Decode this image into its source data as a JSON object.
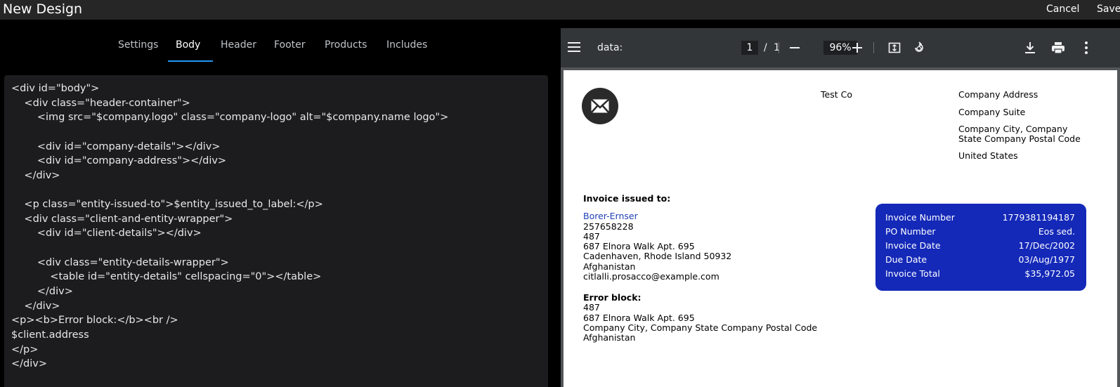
{
  "app": {
    "title": "New Design",
    "cancel_label": "Cancel",
    "save_label": "Save"
  },
  "tabs": [
    {
      "label": "Settings"
    },
    {
      "label": "Body",
      "active": true
    },
    {
      "label": "Header"
    },
    {
      "label": "Footer"
    },
    {
      "label": "Products"
    },
    {
      "label": "Includes"
    }
  ],
  "code": {
    "lines": [
      "<div id=\"body\">",
      "    <div class=\"header-container\">",
      "        <img src=\"$company.logo\" class=\"company-logo\" alt=\"$company.name logo\">",
      "",
      "        <div id=\"company-details\"></div>",
      "        <div id=\"company-address\"></div>",
      "    </div>",
      "",
      "    <p class=\"entity-issued-to\">$entity_issued_to_label:</p>",
      "    <div class=\"client-and-entity-wrapper\">",
      "        <div id=\"client-details\"></div>",
      "",
      "        <div class=\"entity-details-wrapper\">",
      "            <table id=\"entity-details\" cellspacing=\"0\"></table>",
      "        </div>",
      "    </div>",
      "<p><b>Error block:</b><br />",
      "$client.address",
      "</p>",
      "</div>"
    ]
  },
  "viewer": {
    "filename": "data:",
    "page_current": "1",
    "page_separator": "/",
    "page_total": "1",
    "zoom": "96%",
    "icons": {
      "menu": "menu-icon",
      "zoom_out": "minus-icon",
      "zoom_in": "plus-icon",
      "fit": "fit-page-icon",
      "rotate": "rotate-icon",
      "download": "download-icon",
      "print": "print-icon",
      "more": "more-vert-icon"
    }
  },
  "invoice": {
    "company_name": "Test Co",
    "address": [
      "Company Address",
      "Company Suite",
      "Company City, Company",
      "State Company Postal Code",
      "United States"
    ],
    "issued_to_label": "Invoice issued to:",
    "client": {
      "name": "Borer-Ernser",
      "lines": [
        "257658228",
        "487",
        "687 Elnora Walk Apt. 695",
        "Cadenhaven, Rhode Island 50932",
        "Afghanistan",
        "citlalli.prosacco@example.com"
      ]
    },
    "error_block": {
      "label": "Error block:",
      "lines": [
        "487",
        "687 Elnora Walk Apt. 695",
        "Company City, Company State Company Postal Code",
        "Afghanistan"
      ]
    },
    "details": [
      {
        "label": "Invoice Number",
        "value": "1779381194187"
      },
      {
        "label": "PO Number",
        "value": "Eos sed."
      },
      {
        "label": "Invoice Date",
        "value": "17/Dec/2002"
      },
      {
        "label": "Due Date",
        "value": "03/Aug/1977"
      },
      {
        "label": "Invoice Total",
        "value": "$35,972.05"
      }
    ],
    "card_color": "#1429b8"
  }
}
